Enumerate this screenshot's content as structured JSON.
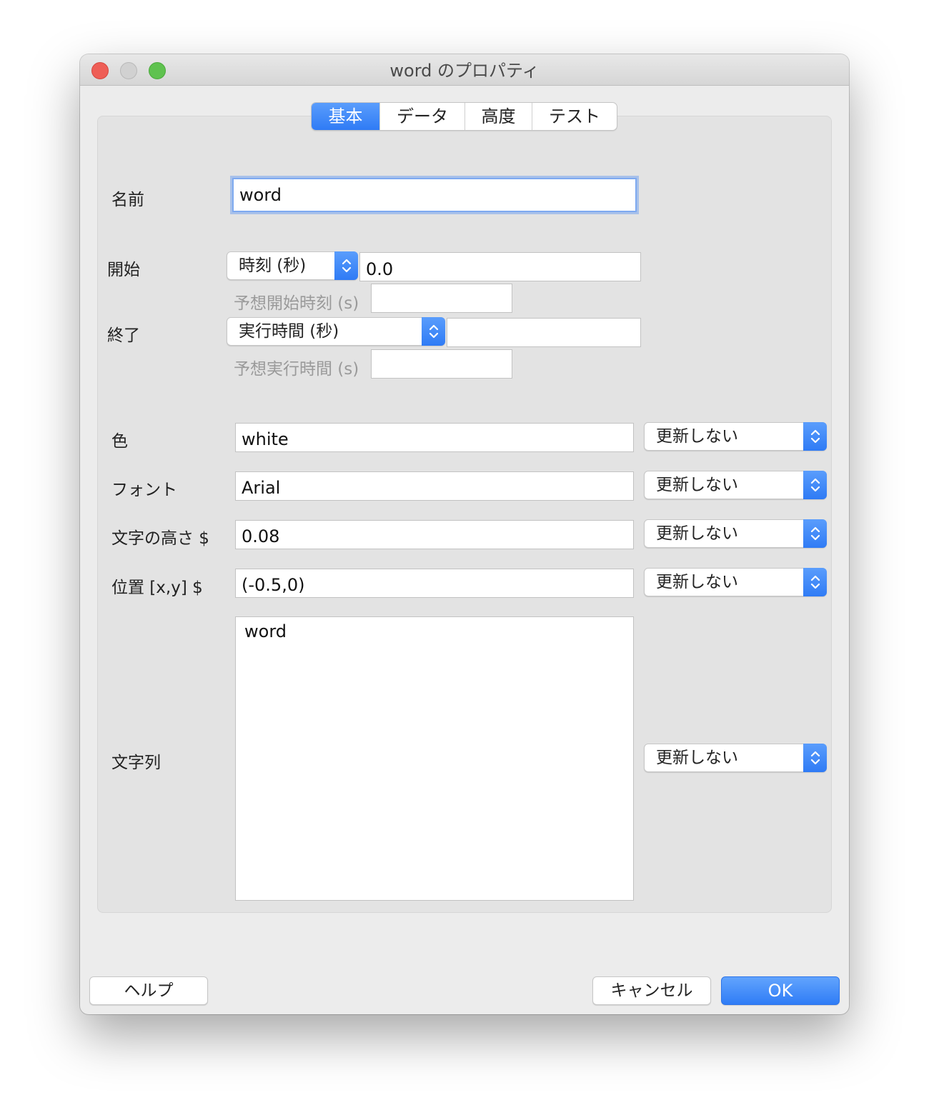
{
  "window": {
    "title": "word のプロパティ"
  },
  "tabs": [
    {
      "label": "基本",
      "active": true
    },
    {
      "label": "データ",
      "active": false
    },
    {
      "label": "高度",
      "active": false
    },
    {
      "label": "テスト",
      "active": false
    }
  ],
  "form": {
    "name": {
      "label": "名前",
      "value": "word"
    },
    "start": {
      "label": "開始",
      "type": "時刻 (秒)",
      "value": "0.0",
      "expected_label": "予想開始時刻 (s)",
      "expected_value": ""
    },
    "stop": {
      "label": "終了",
      "type": "実行時間 (秒)",
      "value": "",
      "expected_label": "予想実行時間 (s)",
      "expected_value": ""
    },
    "color": {
      "label": "色",
      "value": "white",
      "update": "更新しない"
    },
    "font": {
      "label": "フォント",
      "value": "Arial",
      "update": "更新しない"
    },
    "letter_height": {
      "label": "文字の高さ $",
      "value": "0.08",
      "update": "更新しない"
    },
    "position": {
      "label": "位置 [x,y] $",
      "value": "(-0.5,0)",
      "update": "更新しない"
    },
    "text": {
      "label": "文字列",
      "value": "word",
      "update": "更新しない"
    }
  },
  "buttons": {
    "help": "ヘルプ",
    "cancel": "キャンセル",
    "ok": "OK"
  },
  "colors": {
    "accent": "#2f7bf5",
    "window_bg": "#ececec",
    "group_bg": "#e3e3e3"
  }
}
